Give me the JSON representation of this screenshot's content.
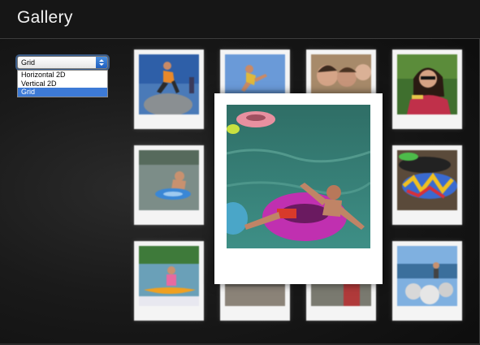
{
  "app": {
    "title": "Gallery"
  },
  "layout_select": {
    "value": "Grid",
    "options": [
      "Horizontal 2D",
      "Vertical 2D",
      "Grid"
    ],
    "selected_index": 2
  },
  "gallery": {
    "thumbnails": [
      {
        "name": "photo-jump-rocks"
      },
      {
        "name": "photo-jump-sky"
      },
      {
        "name": "photo-group-selfie"
      },
      {
        "name": "photo-woman-sunglasses"
      },
      {
        "name": "photo-kid-float"
      },
      {
        "name": "photo-inner-tubes"
      },
      {
        "name": "photo-kayak"
      },
      {
        "name": "photo-beach-rocks"
      }
    ],
    "enlarged": {
      "name": "photo-man-pink-tube"
    }
  }
}
